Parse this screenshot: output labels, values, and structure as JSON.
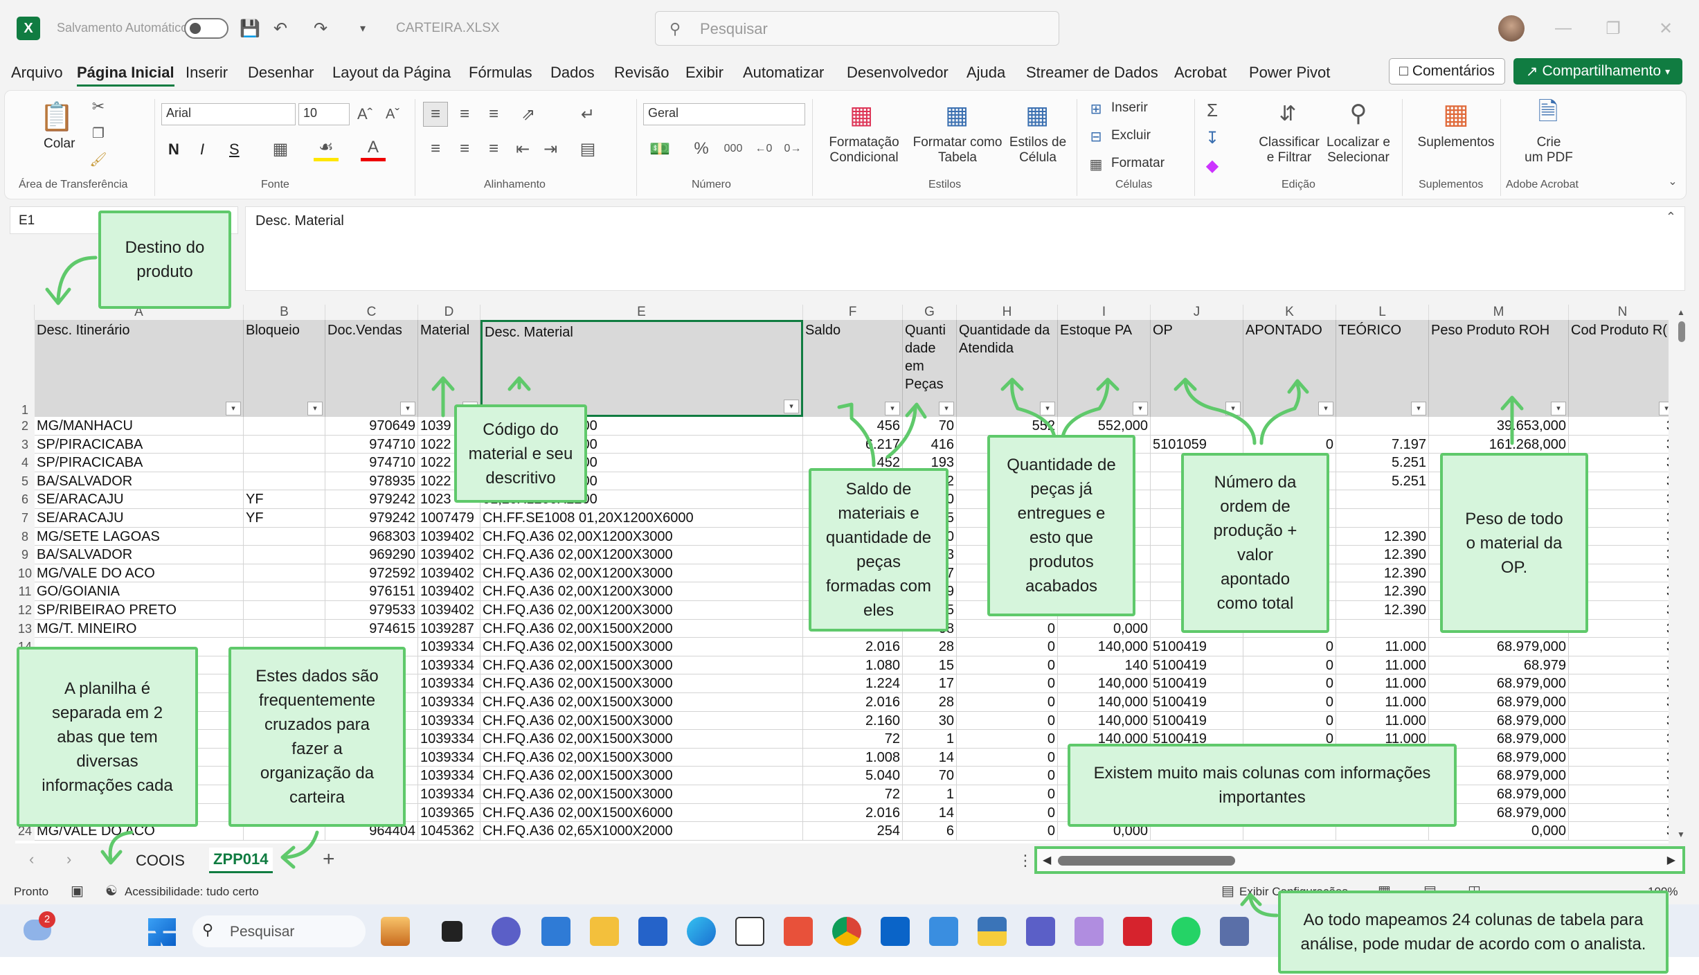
{
  "app": {
    "autosave_label": "Salvamento Automático",
    "filename": "CARTEIRA.XLSX",
    "search_placeholder": "Pesquisar"
  },
  "menu": [
    "Arquivo",
    "Página Inicial",
    "Inserir",
    "Desenhar",
    "Layout da Página",
    "Fórmulas",
    "Dados",
    "Revisão",
    "Exibir",
    "Automatizar",
    "Desenvolvedor",
    "Ajuda",
    "Streamer de Dados",
    "Acrobat",
    "Power Pivot"
  ],
  "buttons": {
    "comments": "Comentários",
    "share": "Compartilhamento"
  },
  "ribbon": {
    "paste": "Colar",
    "font_name": "Arial",
    "font_size": "10",
    "number_format": "Geral",
    "conditional": "Formatação\nCondicional",
    "format_table": "Formatar como\nTabela",
    "cell_styles": "Estilos de\nCélula",
    "insert": "Inserir",
    "delete": "Excluir",
    "format": "Formatar",
    "sort": "Classificar\ne Filtrar",
    "find": "Localizar e\nSelecionar",
    "addins": "Suplementos",
    "pdf": "Crie\num PDF",
    "groups": [
      "Área de Transferência",
      "Fonte",
      "Alinhamento",
      "Número",
      "Estilos",
      "Células",
      "Edição",
      "Suplementos",
      "Adobe Acrobat"
    ],
    "bold": "N",
    "italic": "I",
    "underline": "S"
  },
  "formula": {
    "namebox": "E1",
    "content": "Desc. Material"
  },
  "columns": [
    "A",
    "B",
    "C",
    "D",
    "E",
    "F",
    "G",
    "H",
    "I",
    "J",
    "K",
    "L",
    "M",
    "N"
  ],
  "headers": [
    "Desc. Itinerário",
    "Bloqueio",
    "Doc.Vendas",
    "Material",
    "Desc. Material",
    "Saldo",
    "Quanti\ndade\nem\nPeças",
    "Quantidade da\nAtendida",
    "Estoque PA",
    "OP",
    "APONTADO",
    "TEÓRICO",
    "Peso Produto ROH",
    "Cod Produto R("
  ],
  "rows": [
    [
      "MG/MANHACU",
      "",
      "970649",
      "1039",
      "00,75X1200X2000",
      "456",
      "70",
      "552",
      "552,000",
      "",
      "",
      "",
      "39.653,000",
      "3"
    ],
    [
      "SP/PIRACICABA",
      "",
      "974710",
      "1022",
      "00,90X1200X2000",
      "6.217",
      "416",
      "",
      "",
      "5101059",
      "0",
      "7.197",
      "161.268,000",
      "3"
    ],
    [
      "SP/PIRACICABA",
      "",
      "974710",
      "1022",
      "00,90X1200X3000",
      "452",
      "193",
      "",
      "",
      "",
      "",
      "5.251",
      "",
      "3"
    ],
    [
      "BA/SALVADOR",
      "",
      "978935",
      "1022",
      "00,90X1200X3000",
      "",
      "2",
      "",
      "",
      "",
      "",
      "5.251",
      "",
      "3"
    ],
    [
      "SE/ARACAJU",
      "YF",
      "979242",
      "1023",
      "01,20X1200X2200",
      "",
      "40",
      "",
      "",
      "",
      "",
      "",
      "",
      "3"
    ],
    [
      "SE/ARACAJU",
      "YF",
      "979242",
      "1007479",
      "CH.FF.SE1008 01,20X1200X6000",
      "",
      "15",
      "",
      "",
      "",
      "",
      "",
      "",
      "3"
    ],
    [
      "MG/SETE LAGOAS",
      "",
      "968303",
      "1039402",
      "CH.FQ.A36 02,00X1200X3000",
      "",
      "70",
      "",
      "",
      "",
      "",
      "12.390",
      "",
      "3"
    ],
    [
      "BA/SALVADOR",
      "",
      "969290",
      "1039402",
      "CH.FQ.A36 02,00X1200X3000",
      "",
      "3",
      "",
      "",
      "",
      "",
      "12.390",
      "",
      "3"
    ],
    [
      "MG/VALE DO ACO",
      "",
      "972592",
      "1039402",
      "CH.FQ.A36 02,00X1200X3000",
      "",
      "17",
      "",
      "",
      "",
      "",
      "12.390",
      "",
      "3"
    ],
    [
      "GO/GOIANIA",
      "",
      "976151",
      "1039402",
      "CH.FQ.A36 02,00X1200X3000",
      "",
      "9",
      "",
      "",
      "",
      "",
      "12.390",
      "",
      "3"
    ],
    [
      "SP/RIBEIRAO PRETO",
      "",
      "979533",
      "1039402",
      "CH.FQ.A36 02,00X1200X3000",
      "",
      "15",
      "",
      "",
      "",
      "",
      "12.390",
      "",
      "3"
    ],
    [
      "MG/T. MINEIRO",
      "",
      "974615",
      "1039287",
      "CH.FQ.A36 02,00X1500X2000",
      "",
      "08",
      "0",
      "0,000",
      "",
      "",
      "",
      "",
      "3"
    ],
    [
      "",
      "",
      "",
      "1039334",
      "CH.FQ.A36 02,00X1500X3000",
      "2.016",
      "28",
      "0",
      "140,000",
      "5100419",
      "0",
      "11.000",
      "68.979,000",
      "3"
    ],
    [
      "",
      "",
      "",
      "1039334",
      "CH.FQ.A36 02,00X1500X3000",
      "1.080",
      "15",
      "0",
      "140",
      "5100419",
      "0",
      "11.000",
      "68.979",
      "3"
    ],
    [
      "",
      "",
      "",
      "1039334",
      "CH.FQ.A36 02,00X1500X3000",
      "1.224",
      "17",
      "0",
      "140,000",
      "5100419",
      "0",
      "11.000",
      "68.979,000",
      "3"
    ],
    [
      "",
      "",
      "",
      "1039334",
      "CH.FQ.A36 02,00X1500X3000",
      "2.016",
      "28",
      "0",
      "140,000",
      "5100419",
      "0",
      "11.000",
      "68.979,000",
      "3"
    ],
    [
      "",
      "",
      "",
      "1039334",
      "CH.FQ.A36 02,00X1500X3000",
      "2.160",
      "30",
      "0",
      "140,000",
      "5100419",
      "0",
      "11.000",
      "68.979,000",
      "3"
    ],
    [
      "",
      "",
      "",
      "1039334",
      "CH.FQ.A36 02,00X1500X3000",
      "72",
      "1",
      "0",
      "140,000",
      "5100419",
      "0",
      "11.000",
      "68.979,000",
      "3"
    ],
    [
      "",
      "",
      "",
      "1039334",
      "CH.FQ.A36 02,00X1500X3000",
      "1.008",
      "14",
      "0",
      "",
      "",
      "",
      "",
      "68.979,000",
      "3"
    ],
    [
      "",
      "",
      "",
      "1039334",
      "CH.FQ.A36 02,00X1500X3000",
      "5.040",
      "70",
      "0",
      "",
      "",
      "",
      "",
      "68.979,000",
      "3"
    ],
    [
      "",
      "",
      "",
      "1039334",
      "CH.FQ.A36 02,00X1500X3000",
      "72",
      "1",
      "0",
      "",
      "",
      "",
      "",
      "68.979,000",
      "3"
    ],
    [
      "",
      "",
      "",
      "1039365",
      "CH.FQ.A36 02,00X1500X6000",
      "2.016",
      "14",
      "0",
      "",
      "",
      "",
      "",
      "68.979,000",
      "3"
    ],
    [
      "MG/VALE DO ACO",
      "",
      "964404",
      "1045362",
      "CH.FQ.A36 02,65X1000X2000",
      "254",
      "6",
      "0",
      "0,000",
      "",
      "",
      "",
      "0,000",
      "3"
    ]
  ],
  "sheets": {
    "tab1": "COOIS",
    "tab2": "ZPP014",
    "add": "+"
  },
  "status": {
    "ready": "Pronto",
    "accessibility": "Acessibilidade: tudo certo",
    "display": "Exibir Configurações",
    "zoom": "100%"
  },
  "taskbar": {
    "search": "Pesquisar",
    "badge": "2"
  },
  "annotations": {
    "destino": "Destino do\nproduto",
    "codigo": "Código do\nmaterial e seu\ndescritivo",
    "saldo": "Saldo de\nmateriais e\nquantidade de\npeças\nformadas com\neles",
    "quantidade": "Quantidade de\npeças já\nentregues e\nesto que\nprodutos\nacabados",
    "numero": "Número da\nordem de\nprodução +\nvalor\napontado\ncomo total",
    "peso": "Peso de todo\no material da\nOP.",
    "planilha": "A planilha é\nseparada em 2\nabas que tem\ndiversas\ninformações cada",
    "dados": "Estes dados são\nfrequentemente\ncruzados para\nfazer a\norganização da\ncarteira",
    "colunas": "Existem muito mais colunas com informações\nimportantes",
    "mapeamos": "Ao todo mapeamos 24 colunas de tabela para\nanálise, pode mudar de acordo com o analista."
  },
  "colors": {
    "excel_green": "#107c41",
    "note_bg": "#d6f5dc",
    "note_border": "#5fc96b",
    "header_gray": "#d9d9d9"
  }
}
